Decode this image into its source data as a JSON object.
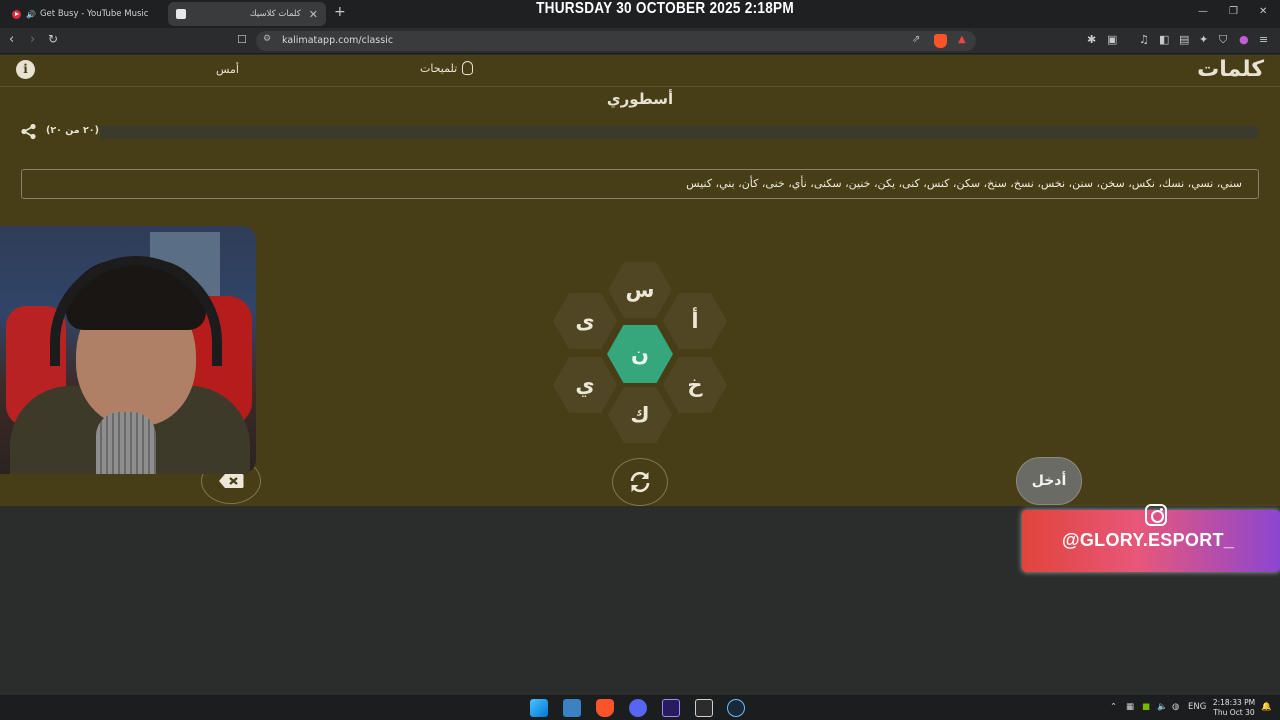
{
  "browser": {
    "tabs": [
      {
        "title": "Get Busy - YouTube Music",
        "active": false
      },
      {
        "title": "كلمات كلاسيك",
        "active": true
      }
    ],
    "url": "kalimatapp.com/classic",
    "datetime_overlay": "THURSDAY 30 OCTOBER 2025 2:18PM"
  },
  "app": {
    "logo": "كلمات",
    "hints_label": "تلميحات",
    "yesterday_label": "أمس",
    "rank": "أسطوري",
    "progress_label": "(٢٠ من ٢٠)",
    "progress_fraction": 1.0,
    "found_words": "سني، نسي، نسك، نكس، سخن، سنن، نخس، نسخ، سنخ، سكن، كنس، كنى، يكن، خنين، سكنى، نأي، خنى، كأن، بني، كنيس",
    "letters": {
      "center": "ن",
      "top": "س",
      "top_right": "أ",
      "bottom_right": "خ",
      "bottom": "ك",
      "bottom_left": "ي",
      "top_left": "ى"
    },
    "submit_label": "أدخل"
  },
  "overlay": {
    "instagram_handle": "@GLORY.ESPORT_"
  },
  "taskbar": {
    "language": "ENG",
    "time": "2:18:33 PM",
    "date": "Thu Oct 30"
  },
  "colors": {
    "page_bg": "#473e17",
    "center_hex": "#36a77d",
    "outer_hex": "#504624"
  }
}
